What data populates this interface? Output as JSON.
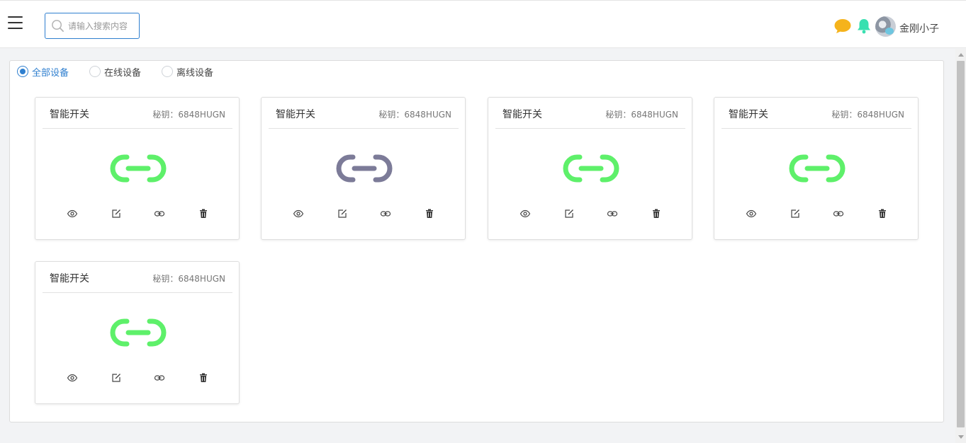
{
  "header": {
    "search": {
      "placeholder": "请输入搜索内容",
      "value": ""
    },
    "username": "金刚小子",
    "icons": {
      "menu": "hamburger-menu-icon",
      "search": "search-icon",
      "chat": "chat-bubble-icon",
      "bell": "bell-icon"
    },
    "colors": {
      "chat": "#f5b31c",
      "bell": "#38e0b0",
      "accent": "#2f7fcf"
    }
  },
  "filters": {
    "options": [
      {
        "label": "全部设备",
        "checked": true
      },
      {
        "label": "在线设备",
        "checked": false
      },
      {
        "label": "离线设备",
        "checked": false
      }
    ]
  },
  "devices": [
    {
      "name": "智能开关",
      "key": "秘钥：6848HUGN",
      "status": "online"
    },
    {
      "name": "智能开关",
      "key": "秘钥：6848HUGN",
      "status": "offline"
    },
    {
      "name": "智能开关",
      "key": "秘钥：6848HUGN",
      "status": "online"
    },
    {
      "name": "智能开关",
      "key": "秘钥：6848HUGN",
      "status": "online"
    },
    {
      "name": "智能开关",
      "key": "秘钥：6848HUGN",
      "status": "online"
    }
  ],
  "status_colors": {
    "online": "#5ef06a",
    "offline": "#7c7b98"
  },
  "card_actions": [
    "view-eye-icon",
    "edit-icon",
    "link-icon",
    "delete-trash-icon"
  ]
}
